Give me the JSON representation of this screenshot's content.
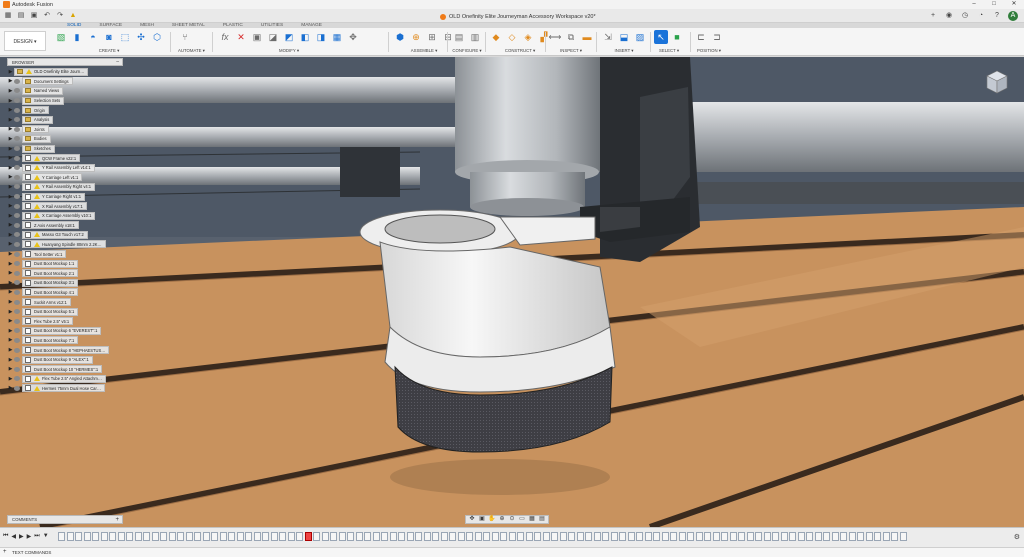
{
  "app": {
    "title": "Autodesk Fusion"
  },
  "document": {
    "title": "OLD Onefinity Elite Journeyman Accessory Workspace v20*"
  },
  "workspace_tabs": [
    "SOLID",
    "SURFACE",
    "MESH",
    "SHEET METAL",
    "PLASTIC",
    "UTILITIES",
    "MANAGE"
  ],
  "active_tab": "SOLID",
  "toolbar": {
    "design_label": "DESIGN ▾",
    "groups": [
      "CREATE ▾",
      "AUTOMATE ▾",
      "MODIFY ▾",
      "ASSEMBLE ▾",
      "CONFIGURE ▾",
      "CONSTRUCT ▾",
      "INSPECT ▾",
      "INSERT ▾",
      "SELECT ▾",
      "POSITION ▾"
    ]
  },
  "browser": {
    "header": "BROWSER",
    "items": [
      {
        "label": "OLD Onefinity Elite Journ…",
        "kind": "root"
      },
      {
        "label": "Document Settings",
        "kind": "folder"
      },
      {
        "label": "Named Views",
        "kind": "folder"
      },
      {
        "label": "Selection Sets",
        "kind": "folder"
      },
      {
        "label": "Origin",
        "kind": "folder"
      },
      {
        "label": "Analysis",
        "kind": "folder"
      },
      {
        "label": "Joints",
        "kind": "folder"
      },
      {
        "label": "Bodies",
        "kind": "folder"
      },
      {
        "label": "Sketches",
        "kind": "folder"
      },
      {
        "label": "QCW Frame v22:1",
        "kind": "warn"
      },
      {
        "label": "Y Rail Assembly Left v14:1",
        "kind": "warn"
      },
      {
        "label": "Y Carriage Left v1:1",
        "kind": "warn"
      },
      {
        "label": "Y Rail Assembly Right v4:1",
        "kind": "warn"
      },
      {
        "label": "Y Carriage Right v1:1",
        "kind": "warn"
      },
      {
        "label": "X Rail Assembly v17:1",
        "kind": "warn"
      },
      {
        "label": "X Carriage Assembly v10:1",
        "kind": "warn"
      },
      {
        "label": "Z Axis Assembly v18:1",
        "kind": "link"
      },
      {
        "label": "Masso G3 Touch v17:2",
        "kind": "warn"
      },
      {
        "label": "Huanyang Spindle 80mm 2.2K…",
        "kind": "warn"
      },
      {
        "label": "Tool Setter v1:1",
        "kind": "link"
      },
      {
        "label": "Dust Boot Mockup 1:1",
        "kind": "comp"
      },
      {
        "label": "Dust Boot Mockup 2:1",
        "kind": "comp"
      },
      {
        "label": "Dust Boot Mockup 3:1",
        "kind": "comp"
      },
      {
        "label": "Dust Boot Mockup 4:1",
        "kind": "comp"
      },
      {
        "label": "Suckit Arms v12:1",
        "kind": "link"
      },
      {
        "label": "Dust Boot Mockup 5:1",
        "kind": "comp"
      },
      {
        "label": "Flex Tube 2.5\" v5:1",
        "kind": "link"
      },
      {
        "label": "Dust Boot Mockup 6 \"EVEREST\":1",
        "kind": "comp"
      },
      {
        "label": "Dust Boot Mockup 7:1",
        "kind": "comp"
      },
      {
        "label": "Dust Boot Mockup 8 \"HEPHAESTUS…",
        "kind": "comp"
      },
      {
        "label": "Dust Boot Mockup 9 \"ALEX\":1",
        "kind": "comp"
      },
      {
        "label": "Dust Boot Mockup 10 \"HERMES\":1",
        "kind": "comp"
      },
      {
        "label": "Flex Tube 2.5\" Angled Attachm…",
        "kind": "warn"
      },
      {
        "label": "Hermes 75mm Dual Hose Car…",
        "kind": "warn"
      }
    ]
  },
  "comments": {
    "label": "COMMENTS"
  },
  "status": {
    "label": "TEXT COMMANDS"
  },
  "colors": {
    "accent": "#0a5eb5",
    "wood": "#c8925e",
    "viewport_bg": "#58616e"
  }
}
